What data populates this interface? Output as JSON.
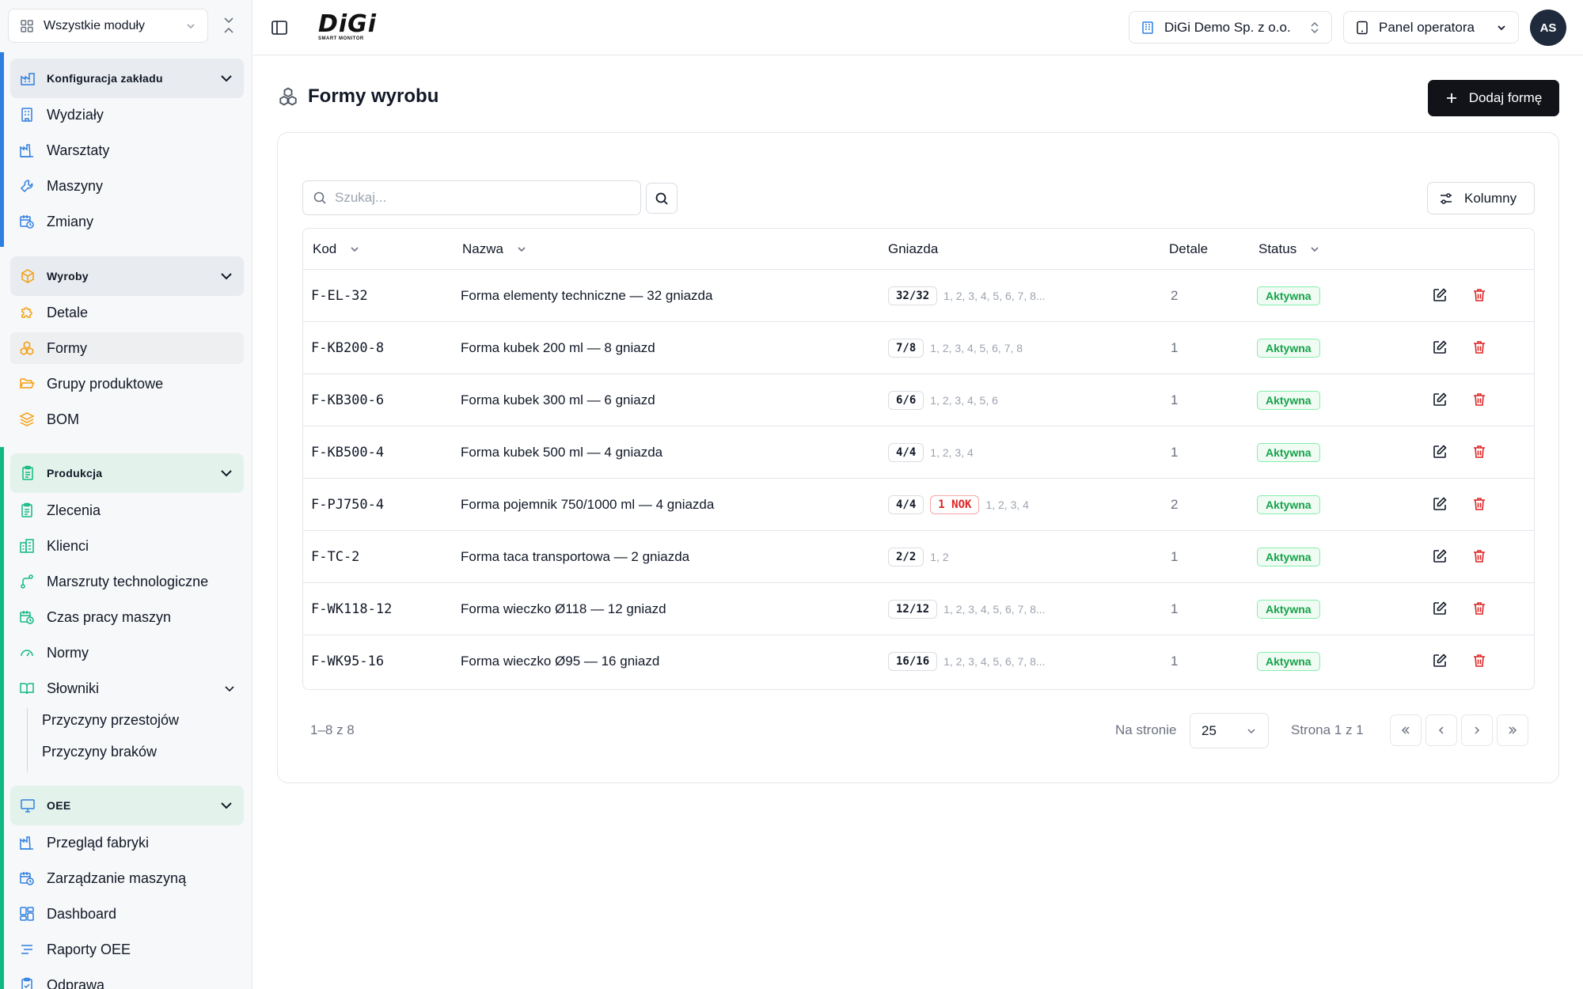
{
  "sidebar": {
    "module_select": "Wszystkie moduły",
    "sections": [
      {
        "title": "Konfiguracja zakładu",
        "color": "#2f7fe0",
        "items": [
          "Wydziały",
          "Warsztaty",
          "Maszyny",
          "Zmiany"
        ]
      },
      {
        "title": "Wyroby",
        "color": "#f59e0b",
        "items": [
          "Detale",
          "Formy",
          "Grupy produktowe",
          "BOM"
        ]
      },
      {
        "title": "Produkcja",
        "color": "#10b981",
        "items": [
          "Zlecenia",
          "Klienci",
          "Marszruty technologiczne",
          "Czas pracy maszyn",
          "Normy",
          "Słowniki"
        ],
        "subitems": [
          "Przyczyny przestojów",
          "Przyczyny braków"
        ]
      },
      {
        "title": "OEE",
        "color": "#10b981",
        "items": [
          "Przegląd fabryki",
          "Zarządzanie maszyną",
          "Dashboard",
          "Raporty OEE",
          "Odprawa"
        ]
      }
    ],
    "active_item": "Formy"
  },
  "topbar": {
    "logo_word": "DiGi",
    "logo_tag": "SMART MONITOR",
    "company": "DiGi Demo Sp. z o.o.",
    "panel": "Panel operatora",
    "avatar": "AS"
  },
  "page": {
    "title": "Formy wyrobu",
    "add_button": "Dodaj formę"
  },
  "table": {
    "search_placeholder": "Szukaj...",
    "columns_button": "Kolumny",
    "headers": {
      "code": "Kod",
      "name": "Nazwa",
      "nests": "Gniazda",
      "details": "Detale",
      "status": "Status"
    },
    "rows": [
      {
        "code": "F-EL-32",
        "name": "Forma elementy techniczne — 32 gniazda",
        "count": "32/32",
        "nok": "",
        "nests": "1, 2, 3, 4, 5, 6, 7, 8...",
        "details": "2",
        "status": "Aktywna"
      },
      {
        "code": "F-KB200-8",
        "name": "Forma kubek 200 ml — 8 gniazd",
        "count": "7/8",
        "nok": "",
        "nests": "1, 2, 3, 4, 5, 6, 7, 8",
        "details": "1",
        "status": "Aktywna"
      },
      {
        "code": "F-KB300-6",
        "name": "Forma kubek 300 ml — 6 gniazd",
        "count": "6/6",
        "nok": "",
        "nests": "1, 2, 3, 4, 5, 6",
        "details": "1",
        "status": "Aktywna"
      },
      {
        "code": "F-KB500-4",
        "name": "Forma kubek 500 ml — 4 gniazda",
        "count": "4/4",
        "nok": "",
        "nests": "1, 2, 3, 4",
        "details": "1",
        "status": "Aktywna"
      },
      {
        "code": "F-PJ750-4",
        "name": "Forma pojemnik 750/1000 ml — 4 gniazda",
        "count": "4/4",
        "nok": "1 NOK",
        "nests": "1, 2, 3, 4",
        "details": "2",
        "status": "Aktywna"
      },
      {
        "code": "F-TC-2",
        "name": "Forma taca transportowa — 2 gniazda",
        "count": "2/2",
        "nok": "",
        "nests": "1, 2",
        "details": "1",
        "status": "Aktywna"
      },
      {
        "code": "F-WK118-12",
        "name": "Forma wieczko Ø118 — 12 gniazd",
        "count": "12/12",
        "nok": "",
        "nests": "1, 2, 3, 4, 5, 6, 7, 8...",
        "details": "1",
        "status": "Aktywna"
      },
      {
        "code": "F-WK95-16",
        "name": "Forma wieczko Ø95 — 16 gniazd",
        "count": "16/16",
        "nok": "",
        "nests": "1, 2, 3, 4, 5, 6, 7, 8...",
        "details": "1",
        "status": "Aktywna"
      }
    ]
  },
  "pagination": {
    "range": "1–8 z 8",
    "per_page_label": "Na stronie",
    "per_page": "25",
    "page_of": "Strona 1 z 1"
  },
  "colors": {
    "blue": "#2f7fe0",
    "orange": "#f59e0b",
    "green": "#10b981",
    "delete": "#dc2626",
    "status_green": "#16a34a"
  }
}
